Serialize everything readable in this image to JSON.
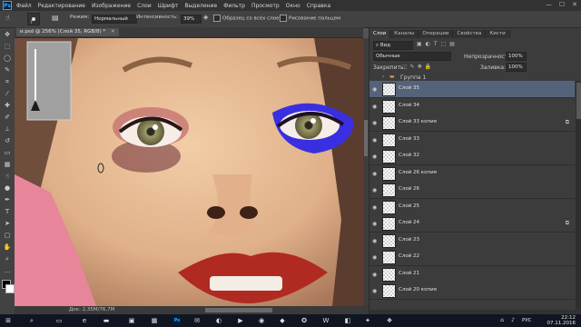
{
  "menubar": {
    "logo": "Ps",
    "items": [
      "Файл",
      "Редактирование",
      "Изображение",
      "Слои",
      "Шрифт",
      "Выделение",
      "Фильтр",
      "Просмотр",
      "Окно",
      "Справка"
    ],
    "win": {
      "minimize": "—",
      "maximize": "☐",
      "close": "✕"
    }
  },
  "options": {
    "brush_size": "7",
    "mode_label": "Режим:",
    "mode_value": "Нормальный",
    "intensity_label": "Интенсивность:",
    "intensity_value": "39%",
    "sample_all_label": "Образец со всех слоев",
    "finger_label": "Рисование пальцем"
  },
  "document": {
    "tab_title": "и.psd @ 256% (Слой 35, RGB/8) *",
    "status": "Док: 2,35M/76,7M"
  },
  "layers_panel": {
    "tabs": [
      "Слои",
      "Каналы",
      "Операции",
      "Свойства",
      "Кисти"
    ],
    "active_tab": "Слои",
    "kind_filter": "Вид",
    "blend_mode": "Обычные",
    "opacity_label": "Непрозрачность:",
    "opacity_value": "100%",
    "lock_label": "Закрепить:",
    "fill_label": "Заливка:",
    "fill_value": "100%",
    "group_name": "Группа 1",
    "layers": [
      {
        "name": "Слой 35",
        "selected": true,
        "fx": false
      },
      {
        "name": "Слой 34",
        "selected": false,
        "fx": false
      },
      {
        "name": "Слой 33 копия",
        "selected": false,
        "fx": true
      },
      {
        "name": "Слой 33",
        "selected": false,
        "fx": false
      },
      {
        "name": "Слой 32",
        "selected": false,
        "fx": false
      },
      {
        "name": "Слой 26 копия",
        "selected": false,
        "fx": false
      },
      {
        "name": "Слой 26",
        "selected": false,
        "fx": false
      },
      {
        "name": "Слой 25",
        "selected": false,
        "fx": false
      },
      {
        "name": "Слой 24",
        "selected": false,
        "fx": true
      },
      {
        "name": "Слой 23",
        "selected": false,
        "fx": false
      },
      {
        "name": "Слой 22",
        "selected": false,
        "fx": false
      },
      {
        "name": "Слой 21",
        "selected": false,
        "fx": false
      },
      {
        "name": "Слой 20 копия",
        "selected": false,
        "fx": false
      }
    ]
  },
  "taskbar": {
    "lang": "РУС",
    "time": "22:12",
    "date": "07.11.2016"
  }
}
